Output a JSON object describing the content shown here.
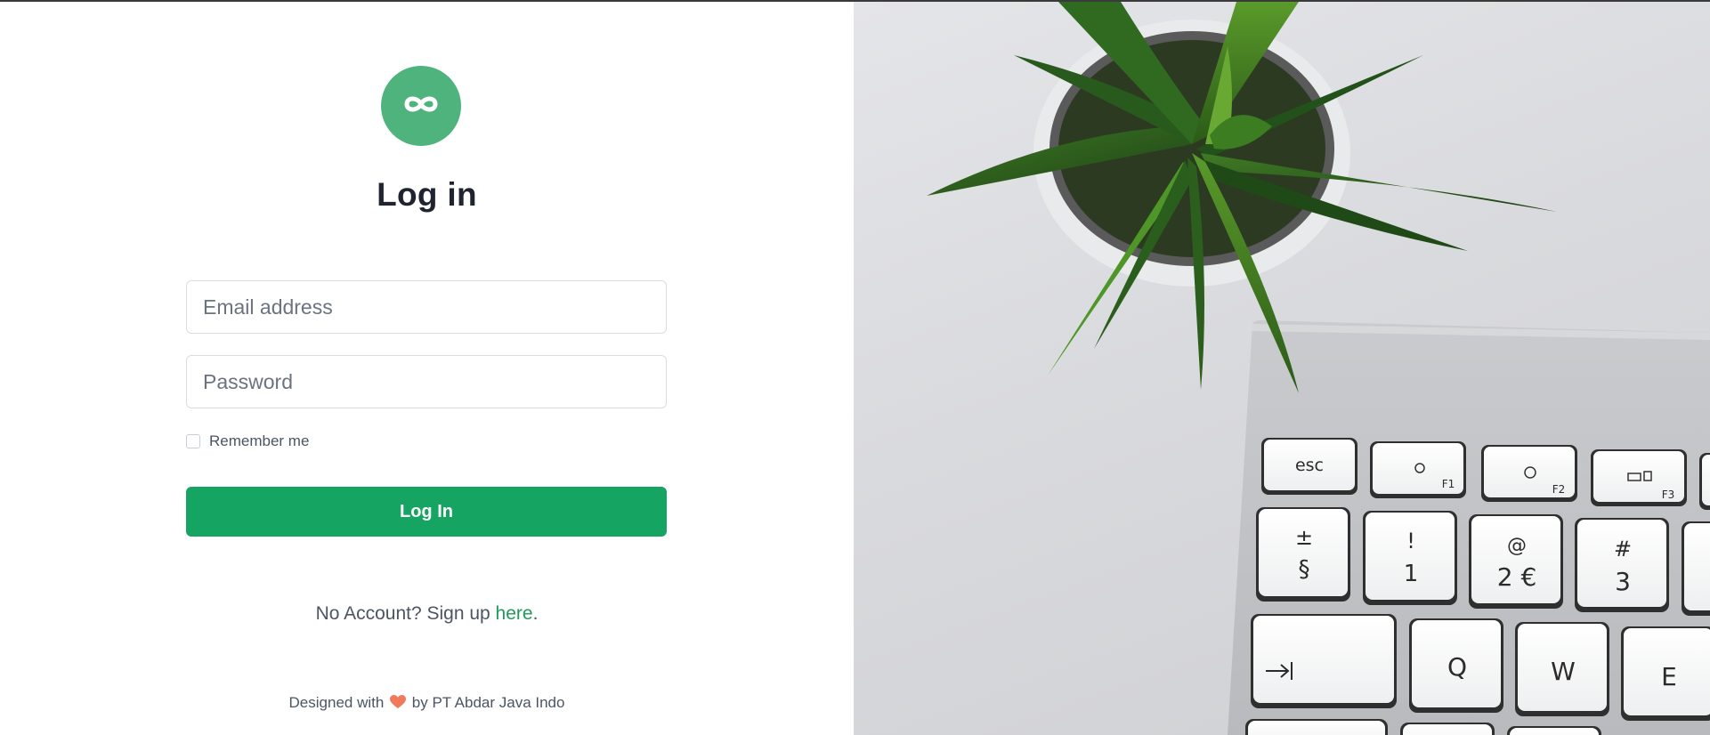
{
  "brand": {
    "logo_icon": "infinity-icon",
    "accent_color": "#16a462",
    "logo_color": "#4fb37d",
    "link_color": "#1f9a5a",
    "heart_color": "#f07a5b"
  },
  "login": {
    "title": "Log in",
    "email_placeholder": "Email address",
    "password_placeholder": "Password",
    "remember_label": "Remember me",
    "submit_label": "Log In"
  },
  "signup": {
    "prefix": "No Account? Sign up ",
    "link": "here",
    "suffix": "."
  },
  "footer": {
    "prefix": "Designed with",
    "heart_icon": "heart-icon",
    "suffix": "by PT Abdar Java Indo"
  },
  "keyboard": {
    "keys": [
      {
        "id": "esc",
        "label": "esc"
      },
      {
        "id": "f1",
        "label": "F1"
      },
      {
        "id": "f2",
        "label": "F2"
      },
      {
        "id": "f3",
        "label": "F3"
      },
      {
        "id": "k1top",
        "label": "±"
      },
      {
        "id": "k1bot",
        "label": "§"
      },
      {
        "id": "k2top",
        "label": "!"
      },
      {
        "id": "k2bot",
        "label": "1"
      },
      {
        "id": "k3top",
        "label": "@"
      },
      {
        "id": "k3bot",
        "label": "2 €"
      },
      {
        "id": "k4top",
        "label": "#"
      },
      {
        "id": "k4bot",
        "label": "3"
      },
      {
        "id": "q",
        "label": "Q"
      },
      {
        "id": "w",
        "label": "W"
      },
      {
        "id": "e",
        "label": "E"
      }
    ]
  }
}
